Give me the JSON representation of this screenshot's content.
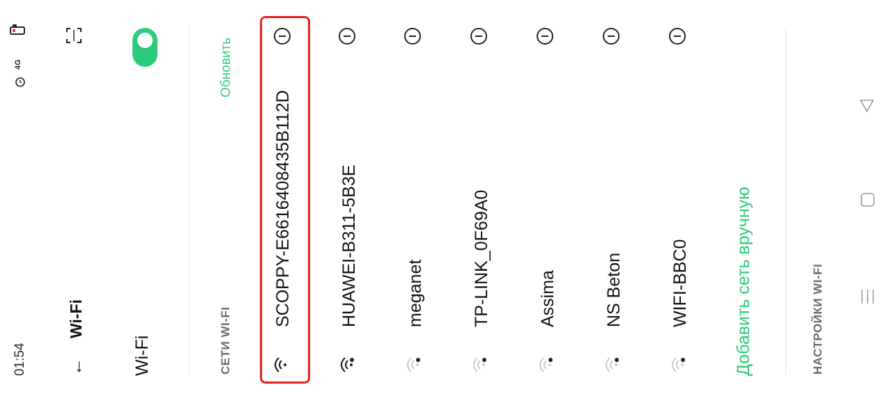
{
  "status_bar": {
    "time": "01:54",
    "signal_text": "4G"
  },
  "header": {
    "title": "Wi-Fi",
    "back_icon": "arrow-back-icon",
    "scan_icon": "qr-scan-icon"
  },
  "wifi_toggle": {
    "label": "Wi-Fi",
    "enabled": true,
    "accent": "#2ecc7a"
  },
  "networks_section": {
    "header": "СЕТИ WI-FI",
    "refresh_label": "Обновить"
  },
  "networks": [
    {
      "name": "SCOPPY-E6616408435B112D",
      "signal": "strong",
      "highlighted": true
    },
    {
      "name": "HUAWEI-B311-5B3E",
      "signal": "strong-locked"
    },
    {
      "name": "meganet",
      "signal": "weak-locked"
    },
    {
      "name": "TP-LINK_0F69A0",
      "signal": "weak-locked"
    },
    {
      "name": "Assima",
      "signal": "weak-locked"
    },
    {
      "name": "NS Beton",
      "signal": "weak-locked"
    },
    {
      "name": "WIFI-BBC0",
      "signal": "weak-locked"
    }
  ],
  "add_network_label": "Добавить сеть вручную",
  "settings_header": "НАСТРОЙКИ WI-FI",
  "nav": {
    "back_icon": "triangle-back-icon",
    "home_icon": "square-home-icon",
    "menu_icon": "menu-lines-icon"
  },
  "colors": {
    "accent": "#2ecc7a",
    "highlight": "#e32222"
  }
}
